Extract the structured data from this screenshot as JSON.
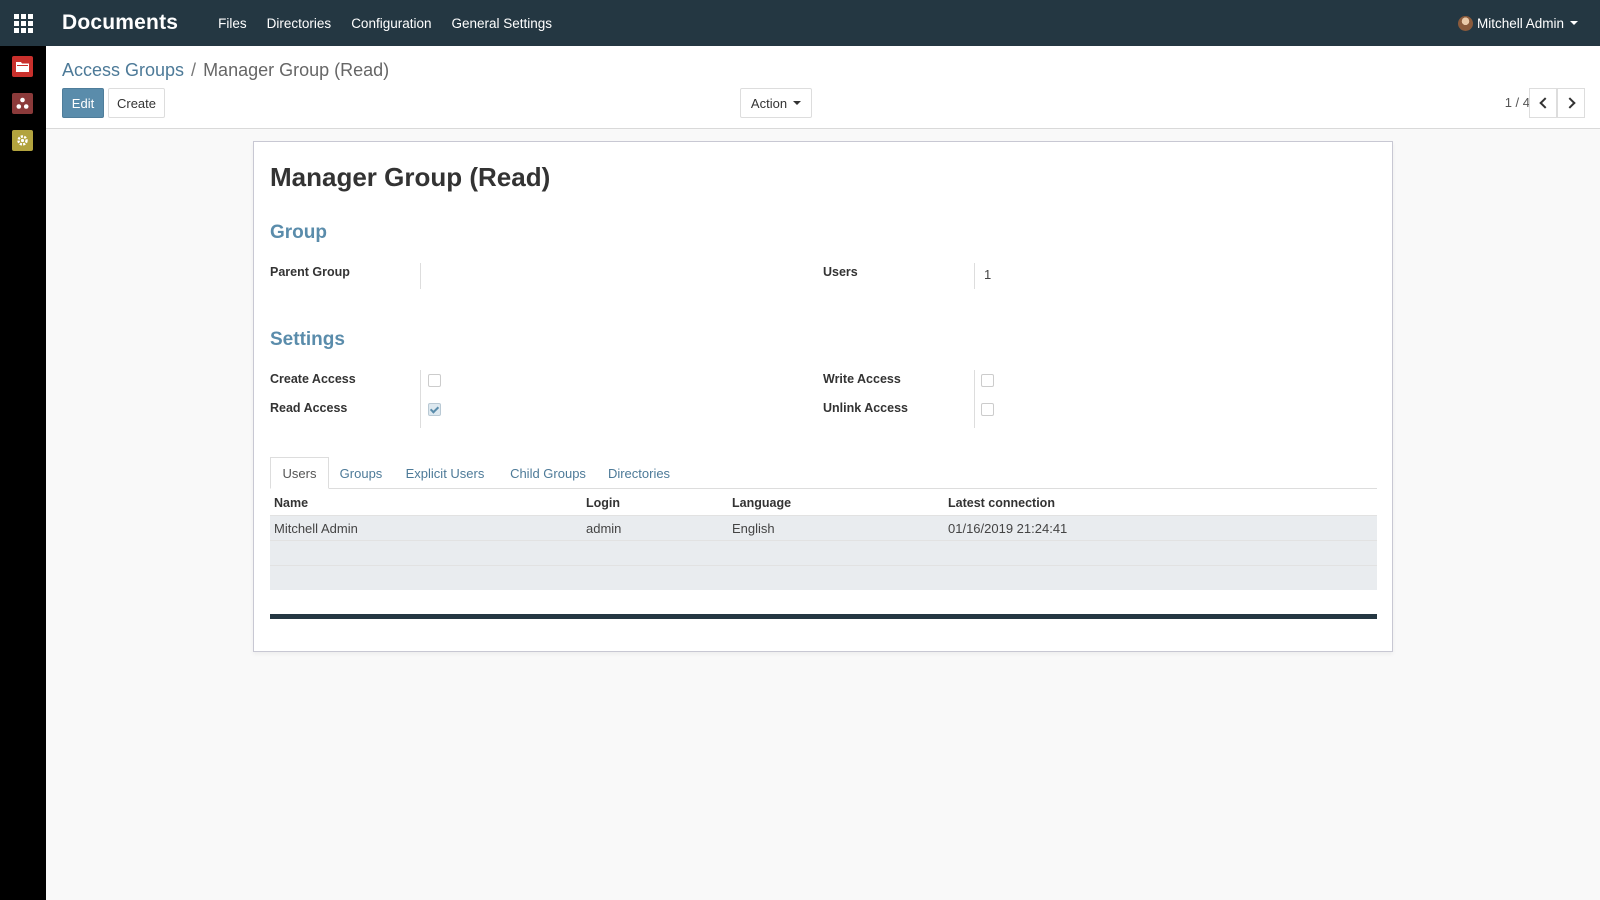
{
  "navbar": {
    "brand": "Documents",
    "menu": [
      "Files",
      "Directories",
      "Configuration",
      "General Settings"
    ],
    "user": "Mitchell Admin"
  },
  "sidebar": {
    "items": [
      {
        "icon": "folder-icon",
        "color": "#c9302c"
      },
      {
        "icon": "share-icon",
        "color": "#8b3a3a"
      },
      {
        "icon": "gear-icon",
        "color": "#b2a33e"
      }
    ]
  },
  "breadcrumb": {
    "parent": "Access Groups",
    "separator": "/",
    "current": "Manager Group (Read)"
  },
  "toolbar": {
    "edit_label": "Edit",
    "create_label": "Create",
    "action_label": "Action"
  },
  "pager": {
    "text": "1 / 4"
  },
  "form": {
    "title": "Manager Group (Read)",
    "group_section": "Group",
    "parent_group_label": "Parent Group",
    "parent_group_value": "",
    "users_label": "Users",
    "users_value": "1",
    "settings_section": "Settings",
    "create_access_label": "Create Access",
    "create_access": false,
    "read_access_label": "Read Access",
    "read_access": true,
    "write_access_label": "Write Access",
    "write_access": false,
    "unlink_access_label": "Unlink Access",
    "unlink_access": false
  },
  "tabs": [
    "Users",
    "Groups",
    "Explicit Users",
    "Child Groups",
    "Directories"
  ],
  "table": {
    "headers": [
      "Name",
      "Login",
      "Language",
      "Latest connection"
    ],
    "rows": [
      [
        "Mitchell Admin",
        "admin",
        "English",
        "01/16/2019 21:24:41"
      ]
    ]
  },
  "colors": {
    "navbar": "#243742",
    "accent": "#5a8cab",
    "link": "#4d7a98"
  }
}
